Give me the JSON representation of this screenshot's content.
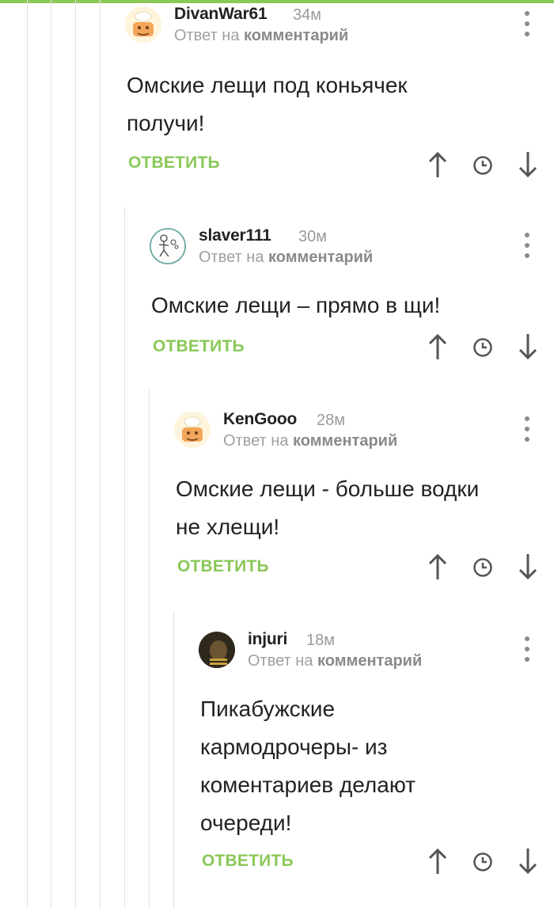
{
  "colors": {
    "accent": "#8ac858",
    "muted": "#9a9a9a"
  },
  "icons": {
    "up": "arrow-up-icon",
    "time": "clock-icon",
    "down": "arrow-down-icon",
    "menu": "more-vertical-icon"
  },
  "comments": [
    {
      "author": "DivanWar61",
      "time": "34м",
      "reply_prefix": "Ответ на",
      "reply_link": "комментарий",
      "lines": [
        "Омские лещи под коньячек",
        "получи!"
      ],
      "reply_label": "ОТВЕТИТЬ"
    },
    {
      "author": "slaver111",
      "time": "30м",
      "reply_prefix": "Ответ на",
      "reply_link": "комментарий",
      "lines": [
        "Омские лещи – прямо в щи!"
      ],
      "reply_label": "ОТВЕТИТЬ"
    },
    {
      "author": "KenGooo",
      "time": "28м",
      "reply_prefix": "Ответ на",
      "reply_link": "комментарий",
      "lines": [
        "Омские лещи - больше водки",
        "не хлещи!"
      ],
      "reply_label": "ОТВЕТИТЬ"
    },
    {
      "author": "injuri",
      "time": "18м",
      "reply_prefix": "Ответ на",
      "reply_link": "комментарий",
      "lines": [
        "Пикабужские",
        "кармодрочеры- из",
        "коментариев делают",
        "очереди!"
      ],
      "reply_label": "ОТВЕТИТЬ"
    }
  ]
}
